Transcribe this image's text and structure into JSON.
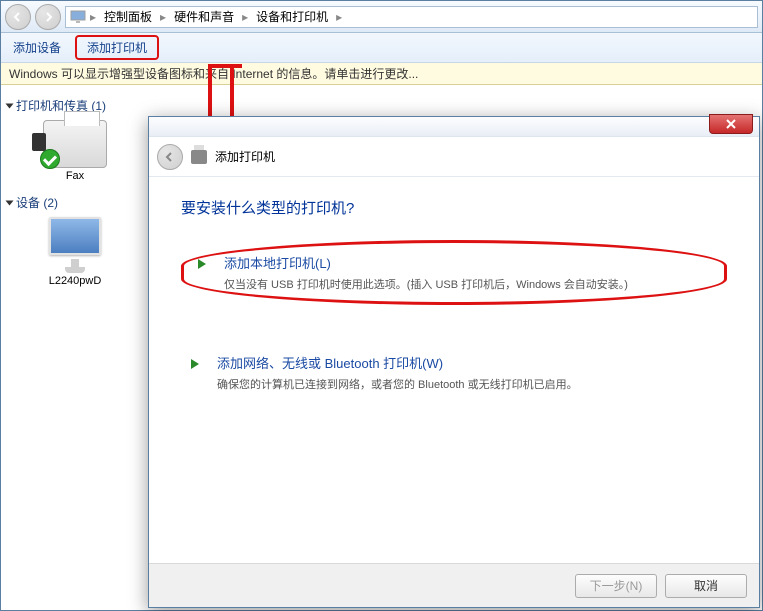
{
  "breadcrumb": {
    "root_icon": "monitor",
    "items": [
      "控制面板",
      "硬件和声音",
      "设备和打印机"
    ]
  },
  "toolbar": {
    "add_device": "添加设备",
    "add_printer": "添加打印机"
  },
  "infobar": {
    "text": "Windows 可以显示增强型设备图标和来自 Internet 的信息。请单击进行更改..."
  },
  "sidebar": {
    "group1_label": "打印机和传真 (1)",
    "group2_label": "设备 (2)",
    "devices": {
      "fax_label": "Fax",
      "monitor_label": "L2240pwD"
    }
  },
  "dialog": {
    "header_title": "添加打印机",
    "heading": "要安装什么类型的打印机?",
    "option1": {
      "title": "添加本地打印机(L)",
      "desc": "仅当没有 USB 打印机时使用此选项。(插入 USB 打印机后，Windows 会自动安装。)"
    },
    "option2": {
      "title": "添加网络、无线或 Bluetooth 打印机(W)",
      "desc": "确保您的计算机已连接到网络，或者您的 Bluetooth 或无线打印机已启用。"
    },
    "footer": {
      "next": "下一步(N)",
      "cancel": "取消"
    }
  }
}
